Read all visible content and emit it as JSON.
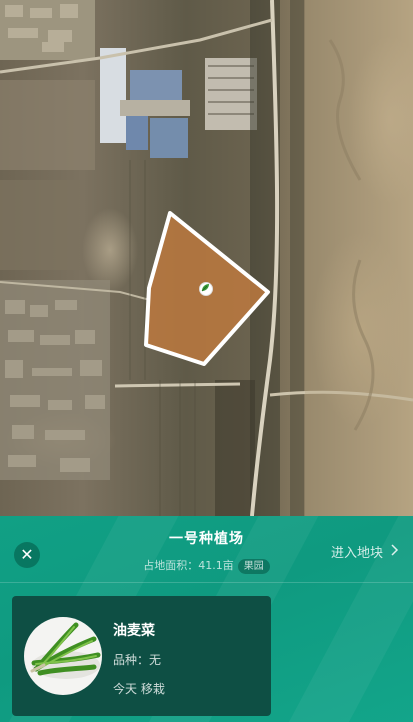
{
  "map": {
    "icons": {
      "field_marker": "leaf-marker-icon"
    },
    "colors": {
      "field_fill": "#c07a3e",
      "field_outline": "#ffffff"
    }
  },
  "panel": {
    "title": "一号种植场",
    "area_label": "占地面积：",
    "area_value": "41.1亩",
    "category_tag": "果园",
    "enter_label": "进入地块",
    "icons": {
      "close": "close-icon",
      "enter": "chevron-right-icon"
    },
    "colors": {
      "background": "#11a085",
      "card": "#0e4f44"
    }
  },
  "crop": {
    "name": "油麦菜",
    "variety_label": "品种：",
    "variety_value": "无",
    "status": "今天 移栽",
    "image_icon": "lettuce-image"
  }
}
